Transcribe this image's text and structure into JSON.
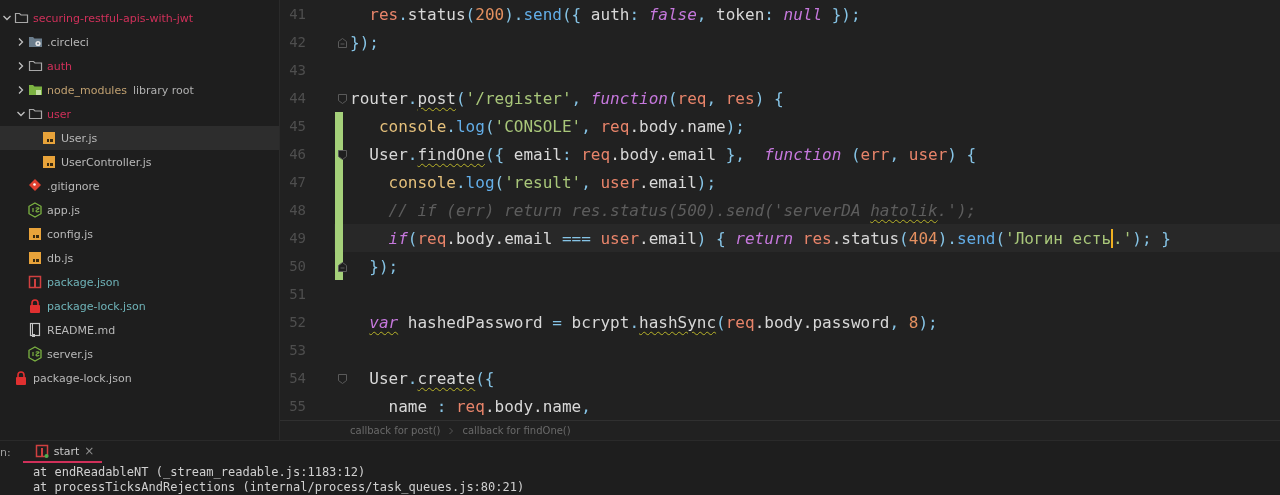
{
  "sidebar": {
    "items": [
      {
        "label": "securing-restful-apis-with-jwt",
        "kind": "folder",
        "expanded": true,
        "selected": false,
        "color": "#d0305a",
        "children": [
          {
            "label": ".circleci",
            "kind": "circleci-folder",
            "expanded": false,
            "selected": false,
            "color": "#b8b8b8"
          },
          {
            "label": "auth",
            "kind": "folder",
            "expanded": false,
            "selected": false,
            "color": "#d0305a"
          },
          {
            "label": "node_modules",
            "extra": "library root",
            "kind": "module-folder",
            "expanded": false,
            "selected": false,
            "color": "#c0a070"
          },
          {
            "label": "user",
            "kind": "folder",
            "expanded": true,
            "selected": false,
            "color": "#d0305a",
            "children": [
              {
                "label": "User.js",
                "kind": "js",
                "selected": true,
                "color": "#b8b8b8"
              },
              {
                "label": "UserController.js",
                "kind": "js",
                "selected": false,
                "color": "#b8b8b8"
              }
            ]
          },
          {
            "label": ".gitignore",
            "kind": "git",
            "selected": false,
            "color": "#b8b8b8"
          },
          {
            "label": "app.js",
            "kind": "node",
            "selected": false,
            "color": "#b8b8b8"
          },
          {
            "label": "config.js",
            "kind": "js",
            "selected": false,
            "color": "#b8b8b8"
          },
          {
            "label": "db.js",
            "kind": "js",
            "selected": false,
            "color": "#b8b8b8"
          },
          {
            "label": "package.json",
            "kind": "npm",
            "selected": false,
            "color": "#6fb3b8"
          },
          {
            "label": "package-lock.json",
            "kind": "lock",
            "selected": false,
            "color": "#6fb3b8"
          },
          {
            "label": "README.md",
            "kind": "readme",
            "selected": false,
            "color": "#b8b8b8"
          },
          {
            "label": "server.js",
            "kind": "node",
            "selected": false,
            "color": "#b8b8b8"
          }
        ]
      },
      {
        "label": "package-lock.json",
        "kind": "lock",
        "selected": false,
        "color": "#b8b8b8"
      }
    ]
  },
  "editor": {
    "lines": [
      {
        "number": "41",
        "tokens": [
          {
            "text": "  res",
            "kind": "param"
          },
          {
            "text": ".",
            "kind": "punct"
          },
          {
            "text": "status"
          },
          {
            "text": "(",
            "kind": "punct"
          },
          {
            "text": "200",
            "kind": "number"
          },
          {
            "text": ").",
            "kind": "punct"
          },
          {
            "text": "send",
            "kind": "fn"
          },
          {
            "text": "({ ",
            "kind": "punct"
          },
          {
            "text": "auth"
          },
          {
            "text": ": ",
            "kind": "punct"
          },
          {
            "text": "false",
            "kind": "keyword"
          },
          {
            "text": ", ",
            "kind": "punct"
          },
          {
            "text": "token"
          },
          {
            "text": ": ",
            "kind": "punct"
          },
          {
            "text": "null",
            "kind": "keyword"
          },
          {
            "text": " });",
            "kind": "punct"
          }
        ]
      },
      {
        "number": "42",
        "fold_end": true,
        "tokens": [
          {
            "text": "});",
            "kind": "punct"
          }
        ]
      },
      {
        "number": "43"
      },
      {
        "number": "44",
        "fold_start": true,
        "tokens": [
          {
            "text": "router"
          },
          {
            "text": ".",
            "kind": "punct"
          },
          {
            "text": "post",
            "warning": true
          },
          {
            "text": "(",
            "kind": "punct"
          },
          {
            "text": "'/register'",
            "kind": "string"
          },
          {
            "text": ", ",
            "kind": "punct"
          },
          {
            "text": "function",
            "kind": "keyword"
          },
          {
            "text": "(",
            "kind": "punct"
          },
          {
            "text": "req",
            "kind": "param"
          },
          {
            "text": ", ",
            "kind": "punct"
          },
          {
            "text": "res",
            "kind": "param"
          },
          {
            "text": ") {",
            "kind": "punct"
          }
        ]
      },
      {
        "number": "45",
        "changed": true,
        "tokens": [
          {
            "text": "   console",
            "kind": "object"
          },
          {
            "text": ".",
            "kind": "punct"
          },
          {
            "text": "log",
            "kind": "fn"
          },
          {
            "text": "(",
            "kind": "punct"
          },
          {
            "text": "'CONSOLE'",
            "kind": "string"
          },
          {
            "text": ", ",
            "kind": "punct"
          },
          {
            "text": "req",
            "kind": "param"
          },
          {
            "text": ".body.name"
          },
          {
            "text": ");",
            "kind": "punct"
          }
        ]
      },
      {
        "number": "46",
        "changed": true,
        "fold_start": true,
        "tokens": [
          {
            "text": "  User"
          },
          {
            "text": ".",
            "kind": "punct"
          },
          {
            "text": "findOne",
            "warning": true
          },
          {
            "text": "({ ",
            "kind": "punct"
          },
          {
            "text": "email"
          },
          {
            "text": ": ",
            "kind": "punct"
          },
          {
            "text": "req",
            "kind": "param"
          },
          {
            "text": ".body.email"
          },
          {
            "text": " },  ",
            "kind": "punct"
          },
          {
            "text": "function",
            "kind": "keyword"
          },
          {
            "text": " (",
            "kind": "punct"
          },
          {
            "text": "err",
            "kind": "param"
          },
          {
            "text": ", ",
            "kind": "punct"
          },
          {
            "text": "user",
            "kind": "param"
          },
          {
            "text": ") {",
            "kind": "punct"
          }
        ]
      },
      {
        "number": "47",
        "changed": true,
        "tokens": [
          {
            "text": "    console",
            "kind": "object"
          },
          {
            "text": ".",
            "kind": "punct"
          },
          {
            "text": "log",
            "kind": "fn"
          },
          {
            "text": "(",
            "kind": "punct"
          },
          {
            "text": "'result'",
            "kind": "string"
          },
          {
            "text": ", ",
            "kind": "punct"
          },
          {
            "text": "user",
            "kind": "param"
          },
          {
            "text": ".email"
          },
          {
            "text": ");",
            "kind": "punct"
          }
        ]
      },
      {
        "number": "48",
        "changed": true,
        "tokens": [
          {
            "text": "    // if (err) return res.status(500).send('serverDA ",
            "kind": "comment"
          },
          {
            "text": "hatolik",
            "kind": "comment",
            "warning": true
          },
          {
            "text": ".');",
            "kind": "comment"
          }
        ]
      },
      {
        "number": "49",
        "changed": true,
        "current": true,
        "tokens": [
          {
            "text": "    if",
            "kind": "keyword"
          },
          {
            "text": "(",
            "kind": "punct"
          },
          {
            "text": "req",
            "kind": "param"
          },
          {
            "text": ".body.email "
          },
          {
            "text": "===",
            "kind": "punct"
          },
          {
            "text": " user",
            "kind": "param"
          },
          {
            "text": ".email"
          },
          {
            "text": ") { ",
            "kind": "punct"
          },
          {
            "text": "return",
            "kind": "keyword"
          },
          {
            "text": " res",
            "kind": "param"
          },
          {
            "text": ".status"
          },
          {
            "text": "(",
            "kind": "punct"
          },
          {
            "text": "404",
            "kind": "number"
          },
          {
            "text": ").",
            "kind": "punct"
          },
          {
            "text": "send",
            "kind": "fn"
          },
          {
            "text": "(",
            "kind": "punct"
          },
          {
            "text": "'Логин есть",
            "kind": "string",
            "caret": true
          },
          {
            "text": ".'",
            "kind": "string"
          },
          {
            "text": "); }",
            "kind": "punct"
          }
        ]
      },
      {
        "number": "50",
        "changed": true,
        "fold_end": true,
        "tokens": [
          {
            "text": "  });",
            "kind": "punct"
          }
        ]
      },
      {
        "number": "51"
      },
      {
        "number": "52",
        "tokens": [
          {
            "text": "  var",
            "kind": "keyword",
            "warning": true
          },
          {
            "text": " hashedPassword "
          },
          {
            "text": "=",
            "kind": "punct"
          },
          {
            "text": " bcrypt"
          },
          {
            "text": ".",
            "kind": "punct"
          },
          {
            "text": "hashSync",
            "warning": true
          },
          {
            "text": "(",
            "kind": "punct"
          },
          {
            "text": "req",
            "kind": "param"
          },
          {
            "text": ".body.password"
          },
          {
            "text": ", ",
            "kind": "punct"
          },
          {
            "text": "8",
            "kind": "number"
          },
          {
            "text": ");",
            "kind": "punct"
          }
        ]
      },
      {
        "number": "53"
      },
      {
        "number": "54",
        "fold_start": true,
        "tokens": [
          {
            "text": "  User"
          },
          {
            "text": ".",
            "kind": "punct"
          },
          {
            "text": "create",
            "warning": true
          },
          {
            "text": "({",
            "kind": "punct"
          }
        ]
      },
      {
        "number": "55",
        "tokens": [
          {
            "text": "    name "
          },
          {
            "text": ": ",
            "kind": "punct"
          },
          {
            "text": "req",
            "kind": "param"
          },
          {
            "text": ".body.name"
          },
          {
            "text": ",",
            "kind": "punct"
          }
        ]
      }
    ],
    "breadcrumbs": [
      "callback for post()",
      "callback for findOne()"
    ]
  },
  "run_panel": {
    "label": "n:",
    "tabs": [
      {
        "label": "start",
        "selected": true,
        "close": "×"
      }
    ],
    "console_lines": [
      "    at endReadableNT (_stream_readable.js:1183:12)",
      "    at processTicksAndRejections (internal/process/task_queues.js:80:21)"
    ]
  }
}
